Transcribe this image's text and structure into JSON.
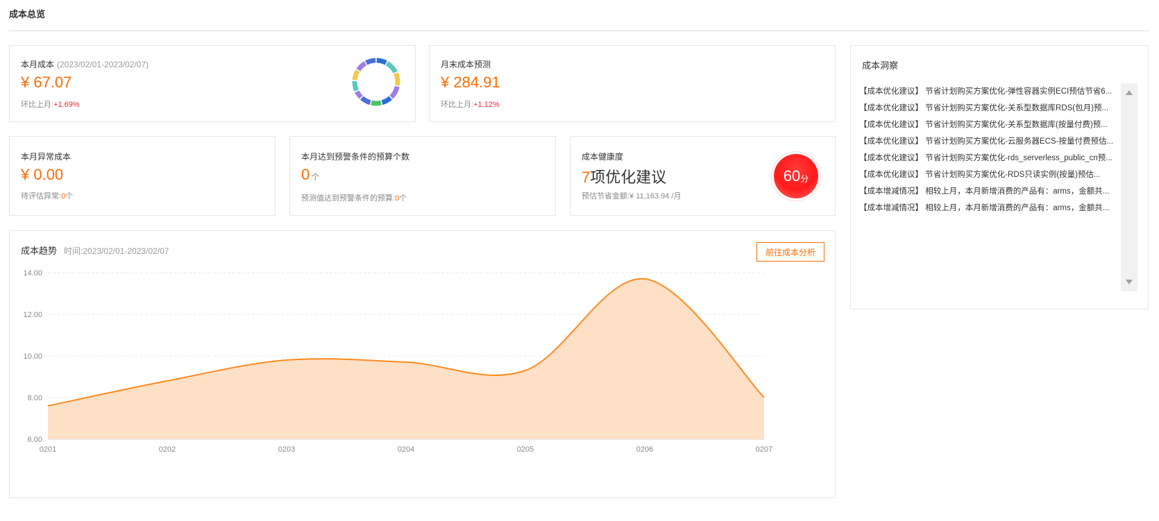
{
  "page": {
    "title": "成本总览"
  },
  "monthly_cost": {
    "label": "本月成本",
    "period": "(2023/02/01-2023/02/07)",
    "value": "¥ 67.07",
    "compare_label": "环比上月:",
    "compare_value": "+1.69%"
  },
  "forecast": {
    "label": "月末成本预测",
    "value": "¥ 284.91",
    "compare_label": "环比上月:",
    "compare_value": "+1.12%"
  },
  "abnormal": {
    "label": "本月异常成本",
    "value": "¥ 0.00",
    "note_label": "待评估异常:",
    "note_value": "0",
    "note_unit": "个"
  },
  "budget": {
    "label": "本月达到预警条件的预算个数",
    "value": "0",
    "unit": "个",
    "note_label": "预测值达到预警条件的预算:",
    "note_value": "0",
    "note_unit": "个"
  },
  "health": {
    "label": "成本健康度",
    "count": "7",
    "text": "项优化建议",
    "savings_label": "预估节省金额:",
    "savings_value": "¥ 11,163.94 /月",
    "score": "60",
    "score_unit": "分"
  },
  "trend": {
    "title": "成本趋势",
    "time_label": "时间:",
    "time_value": "2023/02/01-2023/02/07",
    "button_label": "前往成本分析"
  },
  "insights": {
    "title": "成本洞察",
    "items": [
      "【成本优化建议】 节省计划购买方案优化-弹性容器实例ECI预估节省6...",
      "【成本优化建议】 节省计划购买方案优化-关系型数据库RDS(包月)预...",
      "【成本优化建议】 节省计划购买方案优化-关系型数据库(按量付费)预...",
      "【成本优化建议】 节省计划购买方案优化-云服务器ECS-按量付费预估...",
      "【成本优化建议】 节省计划购买方案优化-rds_serverless_public_cn预...",
      "【成本优化建议】 节省计划购买方案优化-RDS只读实例(按量)预估...",
      "【成本增减情况】 相较上月，本月新增消费的产品有：arms，金额共...",
      "【成本增减情况】 相较上月，本月新增消费的产品有：arms，金额共..."
    ]
  },
  "donut": {
    "segments": [
      {
        "value": 8,
        "color": "#2b6fd6"
      },
      {
        "value": 10,
        "color": "#59c9c0"
      },
      {
        "value": 10,
        "color": "#f2c94c"
      },
      {
        "value": 10,
        "color": "#a07de8"
      },
      {
        "value": 8,
        "color": "#2b6fd6"
      },
      {
        "value": 8,
        "color": "#4cc46a"
      },
      {
        "value": 8,
        "color": "#4a6fd6"
      },
      {
        "value": 6,
        "color": "#a07de8"
      },
      {
        "value": 8,
        "color": "#59c9c0"
      },
      {
        "value": 8,
        "color": "#f2c94c"
      },
      {
        "value": 8,
        "color": "#a07de8"
      },
      {
        "value": 8,
        "color": "#4a6fd6"
      }
    ]
  },
  "chart_data": {
    "type": "area",
    "x": [
      "0201",
      "0202",
      "0203",
      "0204",
      "0205",
      "0206",
      "0207"
    ],
    "series": [
      {
        "values": [
          7.6,
          8.8,
          9.8,
          9.7,
          9.3,
          13.7,
          8.0
        ]
      }
    ],
    "yticks": [
      "6.00",
      "8.00",
      "10.00",
      "12.00",
      "14.00"
    ],
    "ylim": [
      6,
      14
    ],
    "grid": true,
    "line_color": "#ff8a1f",
    "fill_color": "#fde0c6"
  }
}
